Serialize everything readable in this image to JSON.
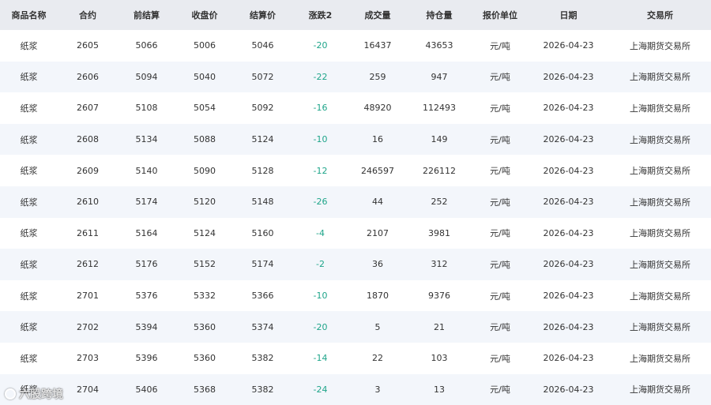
{
  "table": {
    "headers": [
      "商品名称",
      "合约",
      "前结算",
      "收盘价",
      "结算价",
      "涨跌2",
      "成交量",
      "持仓量",
      "报价单位",
      "日期",
      "交易所"
    ],
    "rows": [
      [
        "纸浆",
        "2605",
        "5066",
        "5006",
        "5046",
        "-20",
        "16437",
        "43653",
        "元/吨",
        "2026-04-23",
        "上海期货交易所"
      ],
      [
        "纸浆",
        "2606",
        "5094",
        "5040",
        "5072",
        "-22",
        "259",
        "947",
        "元/吨",
        "2026-04-23",
        "上海期货交易所"
      ],
      [
        "纸浆",
        "2607",
        "5108",
        "5054",
        "5092",
        "-16",
        "48920",
        "112493",
        "元/吨",
        "2026-04-23",
        "上海期货交易所"
      ],
      [
        "纸浆",
        "2608",
        "5134",
        "5088",
        "5124",
        "-10",
        "16",
        "149",
        "元/吨",
        "2026-04-23",
        "上海期货交易所"
      ],
      [
        "纸浆",
        "2609",
        "5140",
        "5090",
        "5128",
        "-12",
        "246597",
        "226112",
        "元/吨",
        "2026-04-23",
        "上海期货交易所"
      ],
      [
        "纸浆",
        "2610",
        "5174",
        "5120",
        "5148",
        "-26",
        "44",
        "252",
        "元/吨",
        "2026-04-23",
        "上海期货交易所"
      ],
      [
        "纸浆",
        "2611",
        "5164",
        "5124",
        "5160",
        "-4",
        "2107",
        "3981",
        "元/吨",
        "2026-04-23",
        "上海期货交易所"
      ],
      [
        "纸浆",
        "2612",
        "5176",
        "5152",
        "5174",
        "-2",
        "36",
        "312",
        "元/吨",
        "2026-04-23",
        "上海期货交易所"
      ],
      [
        "纸浆",
        "2701",
        "5376",
        "5332",
        "5366",
        "-10",
        "1870",
        "9376",
        "元/吨",
        "2026-04-23",
        "上海期货交易所"
      ],
      [
        "纸浆",
        "2702",
        "5394",
        "5360",
        "5374",
        "-20",
        "5",
        "21",
        "元/吨",
        "2026-04-23",
        "上海期货交易所"
      ],
      [
        "纸浆",
        "2703",
        "5396",
        "5360",
        "5382",
        "-14",
        "22",
        "103",
        "元/吨",
        "2026-04-23",
        "上海期货交易所"
      ],
      [
        "纸浆",
        "2704",
        "5406",
        "5368",
        "5382",
        "-24",
        "3",
        "13",
        "元/吨",
        "2026-04-23",
        "上海期货交易所"
      ]
    ]
  },
  "watermark": {
    "text": "六股跨境",
    "icon": "brand-logo-icon"
  },
  "colors": {
    "header_bg": "#e9ebf0",
    "row_alt_bg": "#f3f6fb",
    "change_negative": "#1fa58a"
  }
}
